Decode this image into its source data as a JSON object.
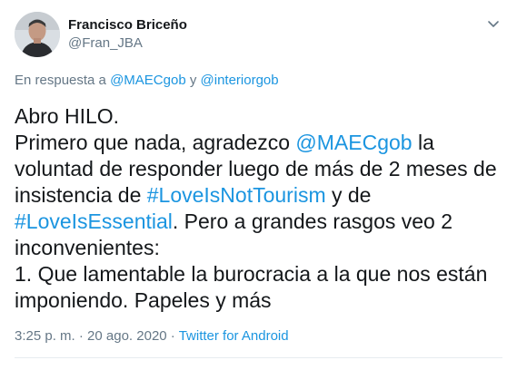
{
  "author": {
    "display_name": "Francisco Briceño",
    "handle": "@Fran_JBA"
  },
  "menu_icon": "chevron-down-icon",
  "reply_context": {
    "prefix": "En respuesta a ",
    "mention_1": "@MAECgob",
    "conjunction": " y ",
    "mention_2": "@interiorgob"
  },
  "body": {
    "line_1": "Abro HILO.",
    "line_2_text": "Primero que nada, agradezco ",
    "line_2_mention": "@MAECgob",
    "line_2_tail": " la",
    "line_3": "voluntad de responder luego de más de 2 meses de",
    "line_4_text": "insistencia de ",
    "line_4_hashtag": "#LoveIsNotTourism",
    "line_4_tail": " y de",
    "line_5_hashtag": "#LoveIsEssential",
    "line_5_tail": ". Pero a grandes rasgos veo 2",
    "line_6": "inconvenientes:",
    "line_7": "1. Que lamentable la burocracia a la que nos están",
    "line_8": "imponiendo. Papeles y más"
  },
  "meta": {
    "time": "3:25 p. m.",
    "separator_1": " · ",
    "date": "20 ago. 2020",
    "separator_2": " · ",
    "source": "Twitter for Android"
  },
  "colors": {
    "link": "#1b95e0",
    "secondary_text": "#657786",
    "primary_text": "#14171a"
  }
}
